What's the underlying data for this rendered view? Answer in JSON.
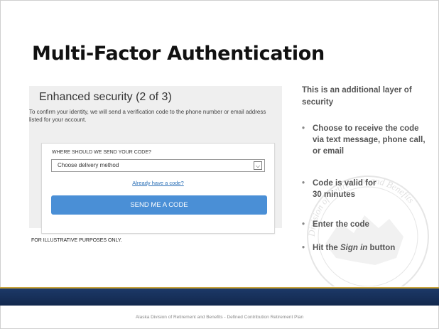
{
  "slide": {
    "title": "Multi-Factor Authentication",
    "caption": "FOR ILLUSTRATIVE PURPOSES ONLY.",
    "footer": "Alaska Division of Retirement and Benefits - Defined Contribution Retirement Plan"
  },
  "screenshot": {
    "heading": "Enhanced security (2 of 3)",
    "description": "To confirm your identity, we will send a verification code to the phone number or email address listed for your account.",
    "field_label": "WHERE SHOULD WE SEND YOUR CODE?",
    "select_value": "Choose delivery method",
    "link_text": "Already have a code?",
    "button_label": "SEND ME A CODE"
  },
  "sidebar": {
    "intro": "This is an additional layer of security",
    "bullets": [
      "Choose to receive the code via text message, phone call, or email",
      "Code is valid for 30 minutes",
      "Enter the code",
      "Hit the Sign in button"
    ]
  },
  "seal_text": "Division of Retirement and Benefits",
  "colors": {
    "button": "#4a8fd6",
    "link": "#2a6fb6",
    "band": "#1d3a6a",
    "accent": "#c9a43a"
  }
}
